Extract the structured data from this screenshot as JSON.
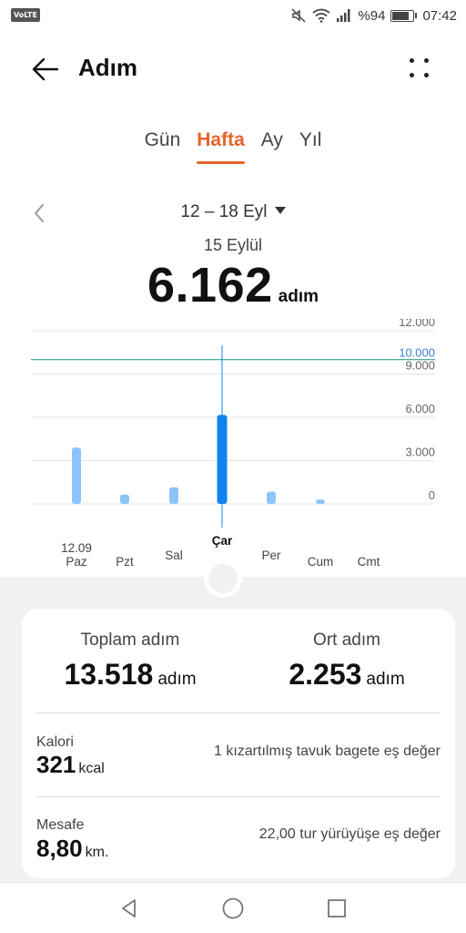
{
  "status_bar": {
    "volte": "VoLTE",
    "battery": "%94",
    "time": "07:42",
    "icons": [
      "mute-icon",
      "wifi-icon",
      "signal-icon",
      "battery-icon"
    ]
  },
  "header": {
    "title": "Adım",
    "back_icon": "arrow-left-icon",
    "more_icon": "more-dots-icon"
  },
  "tabs": [
    {
      "label": "Gün",
      "active": false
    },
    {
      "label": "Hafta",
      "active": true
    },
    {
      "label": "Ay",
      "active": false
    },
    {
      "label": "Yıl",
      "active": false
    }
  ],
  "range": {
    "label": "12 – 18 Eyl",
    "selected_date": "15 Eylül",
    "selected_steps": "6.162",
    "unit": "adım"
  },
  "chart_data": {
    "type": "bar",
    "categories": [
      "Paz",
      "Pzt",
      "Sal",
      "Çar",
      "Per",
      "Cum",
      "Cmt"
    ],
    "first_date_label": "12.09",
    "values": [
      3900,
      650,
      1150,
      6162,
      850,
      300,
      0
    ],
    "selected_index": 3,
    "goal": 10000,
    "goal_label": "10.000",
    "y_ticks": [
      {
        "value": 12000,
        "label": "12.000"
      },
      {
        "value": 9000,
        "label": "9.000"
      },
      {
        "value": 6000,
        "label": "6.000"
      },
      {
        "value": 3000,
        "label": "3.000"
      },
      {
        "value": 0,
        "label": "0"
      }
    ],
    "ylim": [
      0,
      12000
    ],
    "colors": {
      "bar": "#8cc4fa",
      "selected": "#1282f0",
      "goal": "#3aa38f"
    }
  },
  "summary": {
    "total_label": "Toplam adım",
    "total_value": "13.518",
    "total_unit": "adım",
    "avg_label": "Ort adım",
    "avg_value": "2.253",
    "avg_unit": "adım",
    "calories_label": "Kalori",
    "calories_value": "321",
    "calories_unit": "kcal",
    "calories_equivalent": "1 kızartılmış tavuk bagete eş değer",
    "distance_label": "Mesafe",
    "distance_value": "8,80",
    "distance_unit": "km.",
    "distance_equivalent": "22,00 tur yürüyüşe eş değer"
  },
  "nav_bar": {
    "icons": [
      "nav-back-icon",
      "nav-home-icon",
      "nav-recents-icon"
    ]
  }
}
